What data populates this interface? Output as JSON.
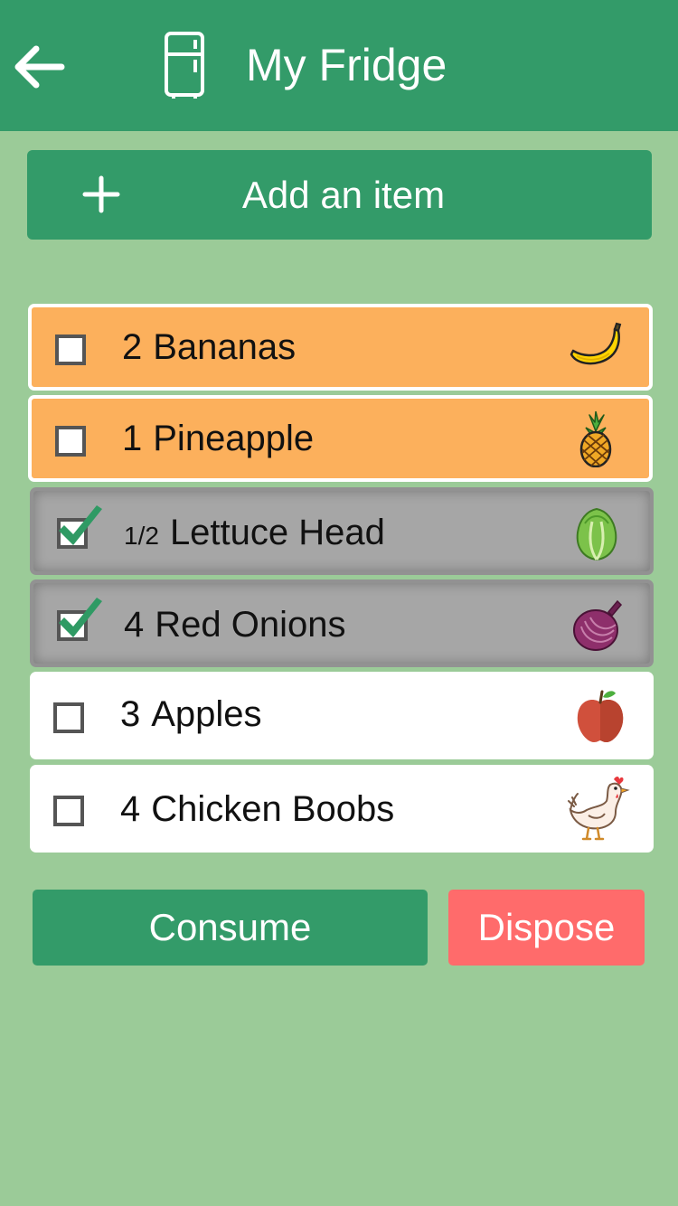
{
  "header": {
    "title": "My Fridge",
    "back_icon": "arrow-left-icon",
    "fridge_icon": "fridge-icon",
    "background_color": "#339b69"
  },
  "add_button": {
    "label": "Add an item",
    "icon": "plus-icon"
  },
  "items": [
    {
      "quantity": "2",
      "name": "Bananas",
      "checked": false,
      "state": "expiring",
      "icon": "banana-icon"
    },
    {
      "quantity": "1",
      "name": "Pineapple",
      "checked": false,
      "state": "expiring",
      "icon": "pineapple-icon"
    },
    {
      "quantity": "1/2",
      "name": "Lettuce Head",
      "checked": true,
      "state": "selected",
      "icon": "lettuce-icon"
    },
    {
      "quantity": "4",
      "name": "Red Onions",
      "checked": true,
      "state": "selected",
      "icon": "red-onion-icon"
    },
    {
      "quantity": "3",
      "name": "Apples",
      "checked": false,
      "state": "normal",
      "icon": "apple-icon"
    },
    {
      "quantity": "4",
      "name": "Chicken Boobs",
      "checked": false,
      "state": "normal",
      "icon": "chicken-icon"
    }
  ],
  "actions": {
    "consume_label": "Consume",
    "dispose_label": "Dispose"
  },
  "colors": {
    "background": "#9bcb98",
    "primary": "#339b69",
    "expiring": "#fcb05c",
    "selected": "#a6a6a6",
    "dispose": "#ff6b6b"
  }
}
